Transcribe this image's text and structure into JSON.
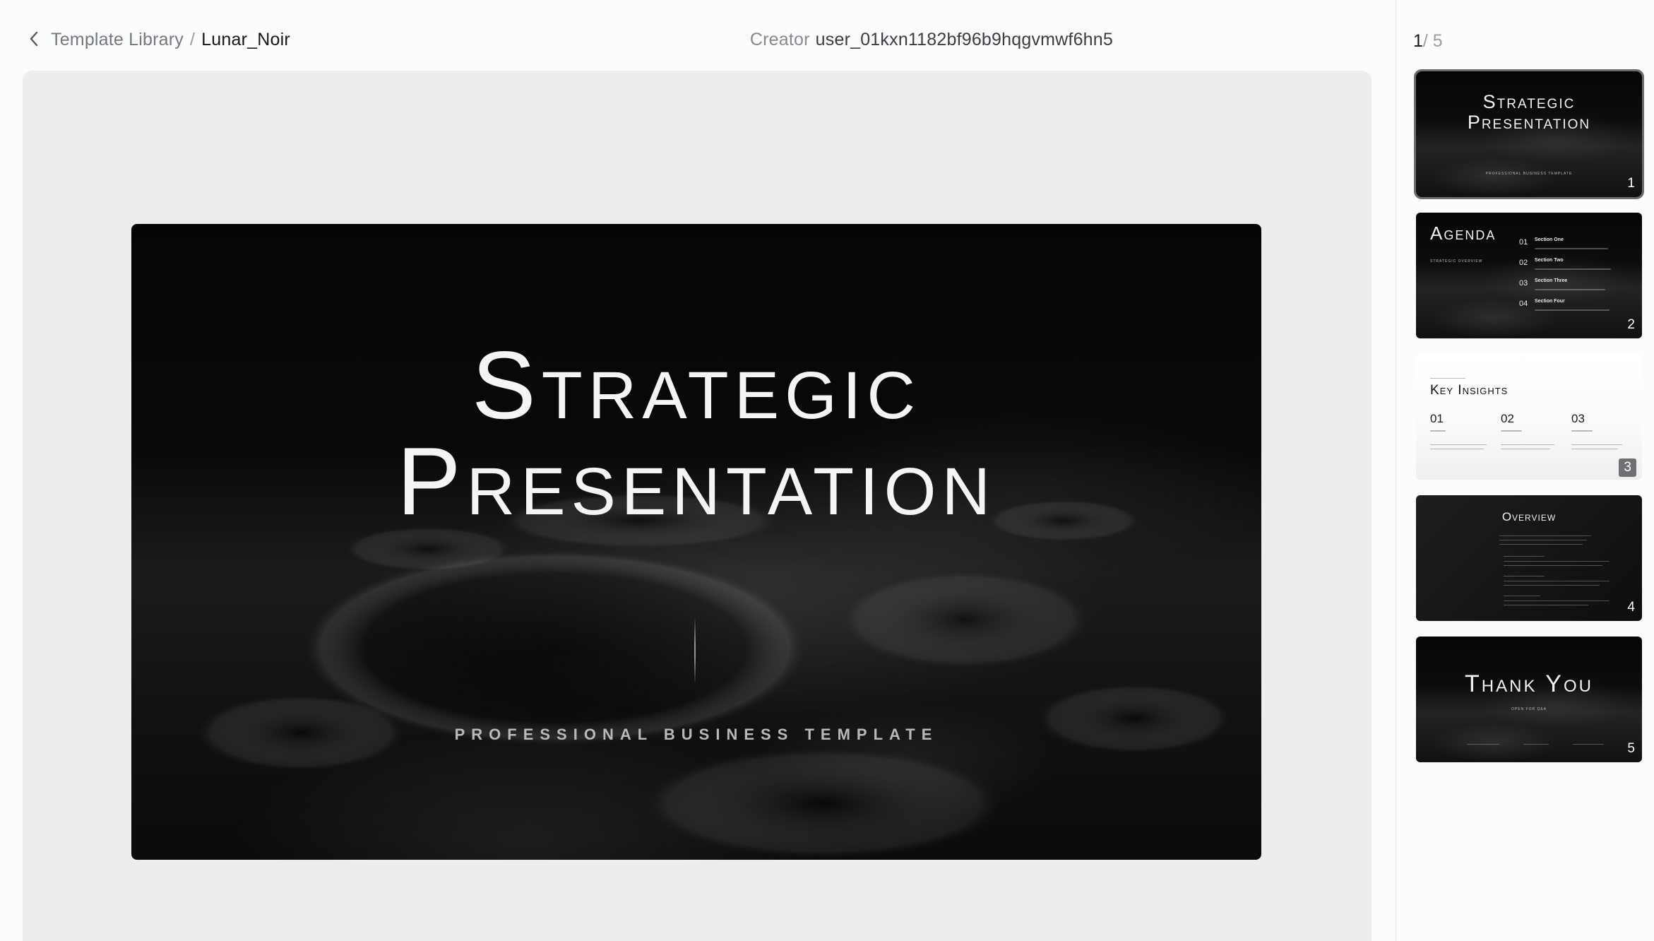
{
  "header": {
    "back_icon": "chevron-left-icon",
    "breadcrumb_parent": "Template Library",
    "breadcrumb_separator": "/",
    "breadcrumb_current": "Lunar_Noir",
    "creator_label": "Creator",
    "creator_value": "user_01kxn1182bf96b9hqgvmwf6hn5"
  },
  "slide": {
    "title_line1": "Strategic",
    "title_line2": "Presentation",
    "subtitle": "PROFESSIONAL BUSINESS TEMPLATE"
  },
  "panel": {
    "current_page": "1",
    "total_pages": "/ 5",
    "thumbnails": [
      {
        "number": "1",
        "title_line1": "Strategic",
        "title_line2": "Presentation",
        "subtitle": "PROFESSIONAL BUSINESS TEMPLATE",
        "active": true
      },
      {
        "number": "2",
        "title": "Agenda",
        "subtitle": "STRATEGIC OVERVIEW",
        "items": [
          {
            "num": "01",
            "label": "Section One"
          },
          {
            "num": "02",
            "label": "Section Two"
          },
          {
            "num": "03",
            "label": "Section Three"
          },
          {
            "num": "04",
            "label": "Section Four"
          }
        ]
      },
      {
        "number": "3",
        "title": "Key Insights",
        "items": [
          {
            "num": "01"
          },
          {
            "num": "02"
          },
          {
            "num": "03"
          }
        ]
      },
      {
        "number": "4",
        "title": "Overview"
      },
      {
        "number": "5",
        "title": "Thank You",
        "subtitle": "OPEN FOR Q&A"
      }
    ]
  },
  "colors": {
    "page_bg": "#fbfcfc",
    "stage_bg": "#ededee",
    "slide_bg": "#0a0a0a",
    "text_primary": "#15171a",
    "text_muted": "#74787f"
  }
}
